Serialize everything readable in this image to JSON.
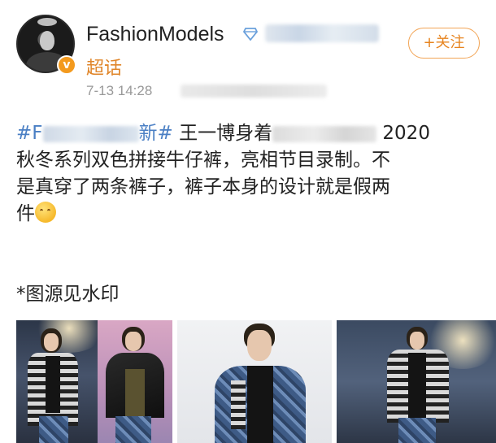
{
  "post": {
    "username": "FashionModels",
    "supertopic_label": "超话",
    "timestamp": "7-13 14:28",
    "follow_label": "+关注",
    "content": {
      "line1_topic_start": "#F",
      "line1_topic_end": "新#",
      "line1_text_a": " 王一博身着",
      "line1_text_b": " 2020",
      "line2": "秋冬系列双色拼接牛仔裤，亮相节目录制。不",
      "line3": "是真穿了两条裤子，裤子本身的设计就是假两",
      "line4": "件"
    },
    "caption": "*图源见水印",
    "icons": {
      "verified": "verified-v-badge-icon",
      "member": "diamond-member-icon",
      "emoji": "smiling-hug-emoji-icon"
    },
    "colors": {
      "topic_link": "#4a7fc4",
      "supertopic": "#e0862a",
      "follow": "#e7841f"
    }
  }
}
